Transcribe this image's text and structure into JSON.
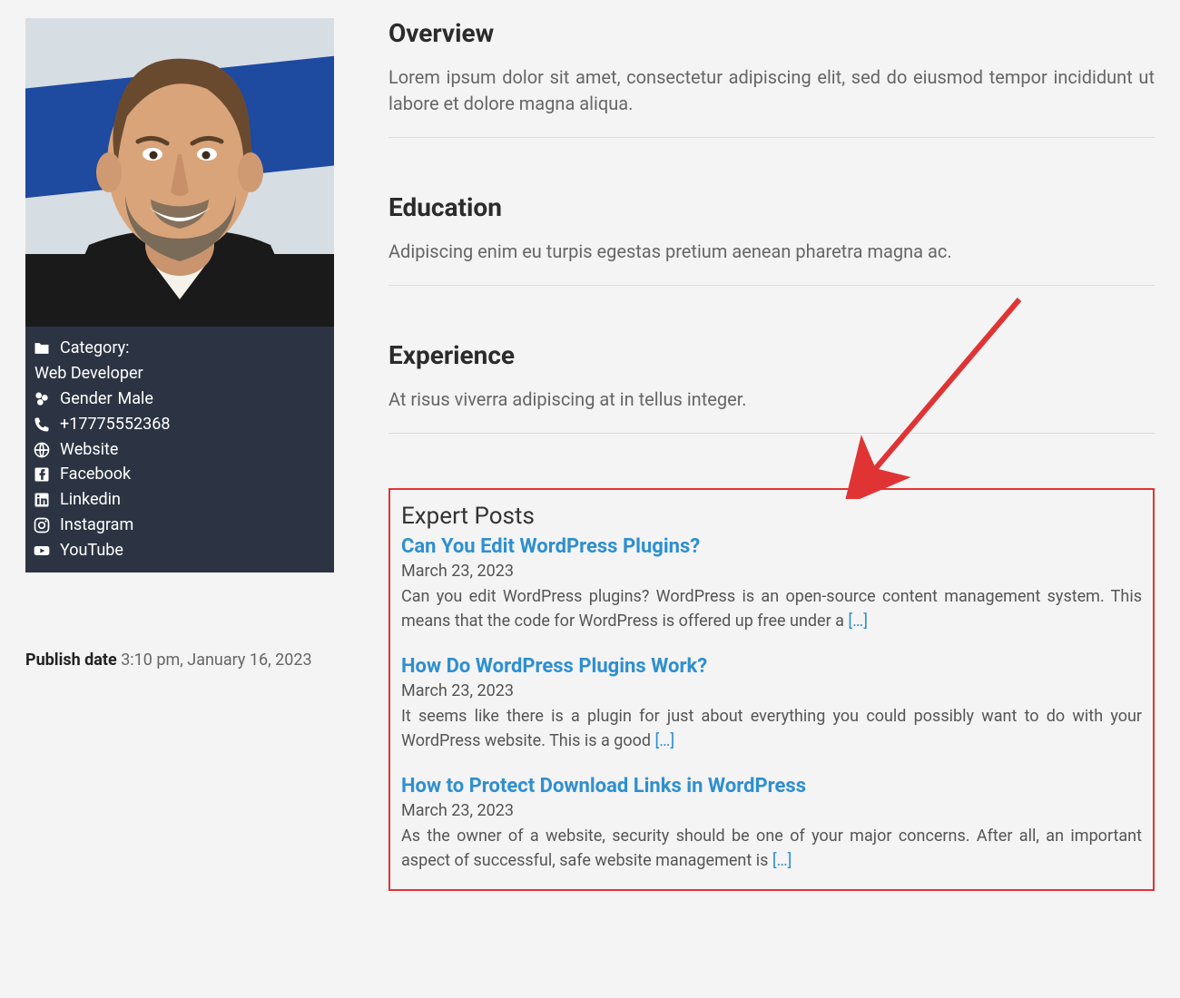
{
  "sidebar": {
    "category_label": "Category:",
    "category_value": "Web Developer",
    "gender_label": "Gender",
    "gender_value": "Male",
    "phone": "+17775552368",
    "links": {
      "website": "Website",
      "facebook": "Facebook",
      "linkedin": "Linkedin",
      "instagram": "Instagram",
      "youtube": "YouTube"
    }
  },
  "publish": {
    "label": "Publish date",
    "value": "3:10 pm, January 16, 2023"
  },
  "sections": {
    "overview": {
      "heading": "Overview",
      "body": "Lorem ipsum dolor sit amet, consectetur adipiscing elit, sed do eiusmod tempor incididunt ut labore et dolore magna aliqua."
    },
    "education": {
      "heading": "Education",
      "body": "Adipiscing enim eu turpis egestas pretium aenean pharetra magna ac."
    },
    "experience": {
      "heading": "Experience",
      "body": "At risus viverra adipiscing at in tellus integer."
    }
  },
  "posts": {
    "heading": "Expert Posts",
    "read_more": "[…]",
    "items": [
      {
        "title": "Can You Edit WordPress Plugins?",
        "date": "March 23, 2023",
        "excerpt": "Can you edit WordPress plugins? WordPress is an open-source content management system. This means that the code for WordPress is offered up free under a "
      },
      {
        "title": "How Do WordPress Plugins Work?",
        "date": "March 23, 2023",
        "excerpt": "It seems like there is a plugin for just about everything you could possibly want to do with your WordPress website. This is a good "
      },
      {
        "title": "How to Protect Download Links in WordPress",
        "date": "March 23, 2023",
        "excerpt": "As the owner of a website, security should be one of your major concerns. After all, an important aspect of successful, safe website management is "
      }
    ]
  }
}
